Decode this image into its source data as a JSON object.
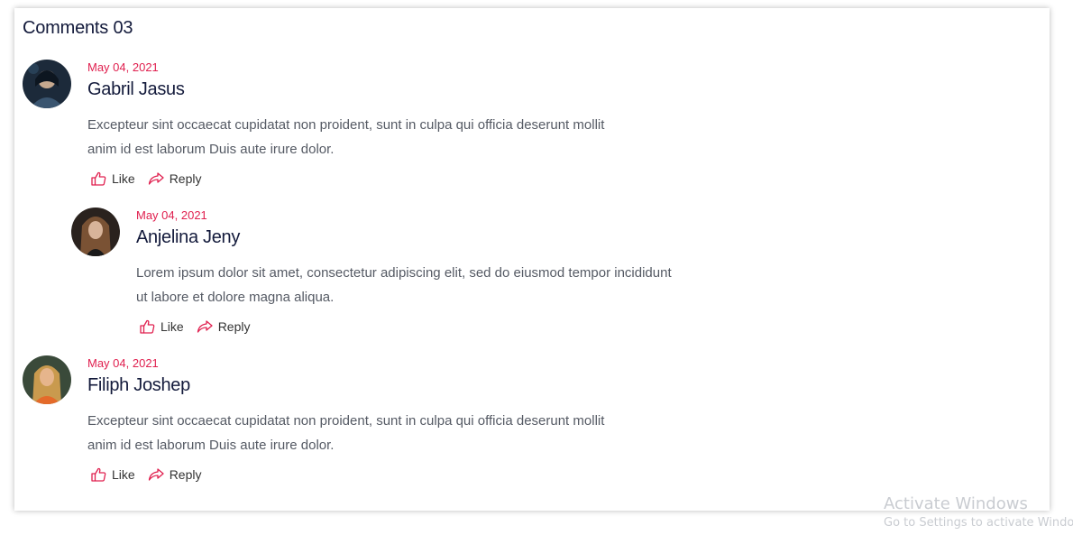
{
  "comments_heading": "Comments 03",
  "comments": [
    {
      "date": "May 04, 2021",
      "author": "Gabril Jasus",
      "text": "Excepteur sint occaecat cupidatat non proident, sunt in culpa qui officia deserunt mollit anim id est laborum Duis aute irure dolor.",
      "like_label": "Like",
      "reply_label": "Reply"
    },
    {
      "date": "May 04, 2021",
      "author": "Anjelina Jeny",
      "text": "Lorem ipsum dolor sit amet, consectetur adipiscing elit, sed do eiusmod tempor incididunt ut labore et dolore magna aliqua.",
      "like_label": "Like",
      "reply_label": "Reply"
    },
    {
      "date": "May 04, 2021",
      "author": "Filiph Joshep",
      "text": "Excepteur sint occaecat cupidatat non proident, sunt in culpa qui officia deserunt mollit anim id est laborum Duis aute irure dolor.",
      "like_label": "Like",
      "reply_label": "Reply"
    }
  ],
  "colors": {
    "accent": "#e0204f",
    "heading": "#131a3b",
    "body_text": "#555a64"
  },
  "icons": {
    "like": "thumbs-up-icon",
    "reply": "share-arrow-icon"
  },
  "watermark": {
    "line1": "Activate Windows",
    "line2": "Go to Settings to activate Windows."
  }
}
